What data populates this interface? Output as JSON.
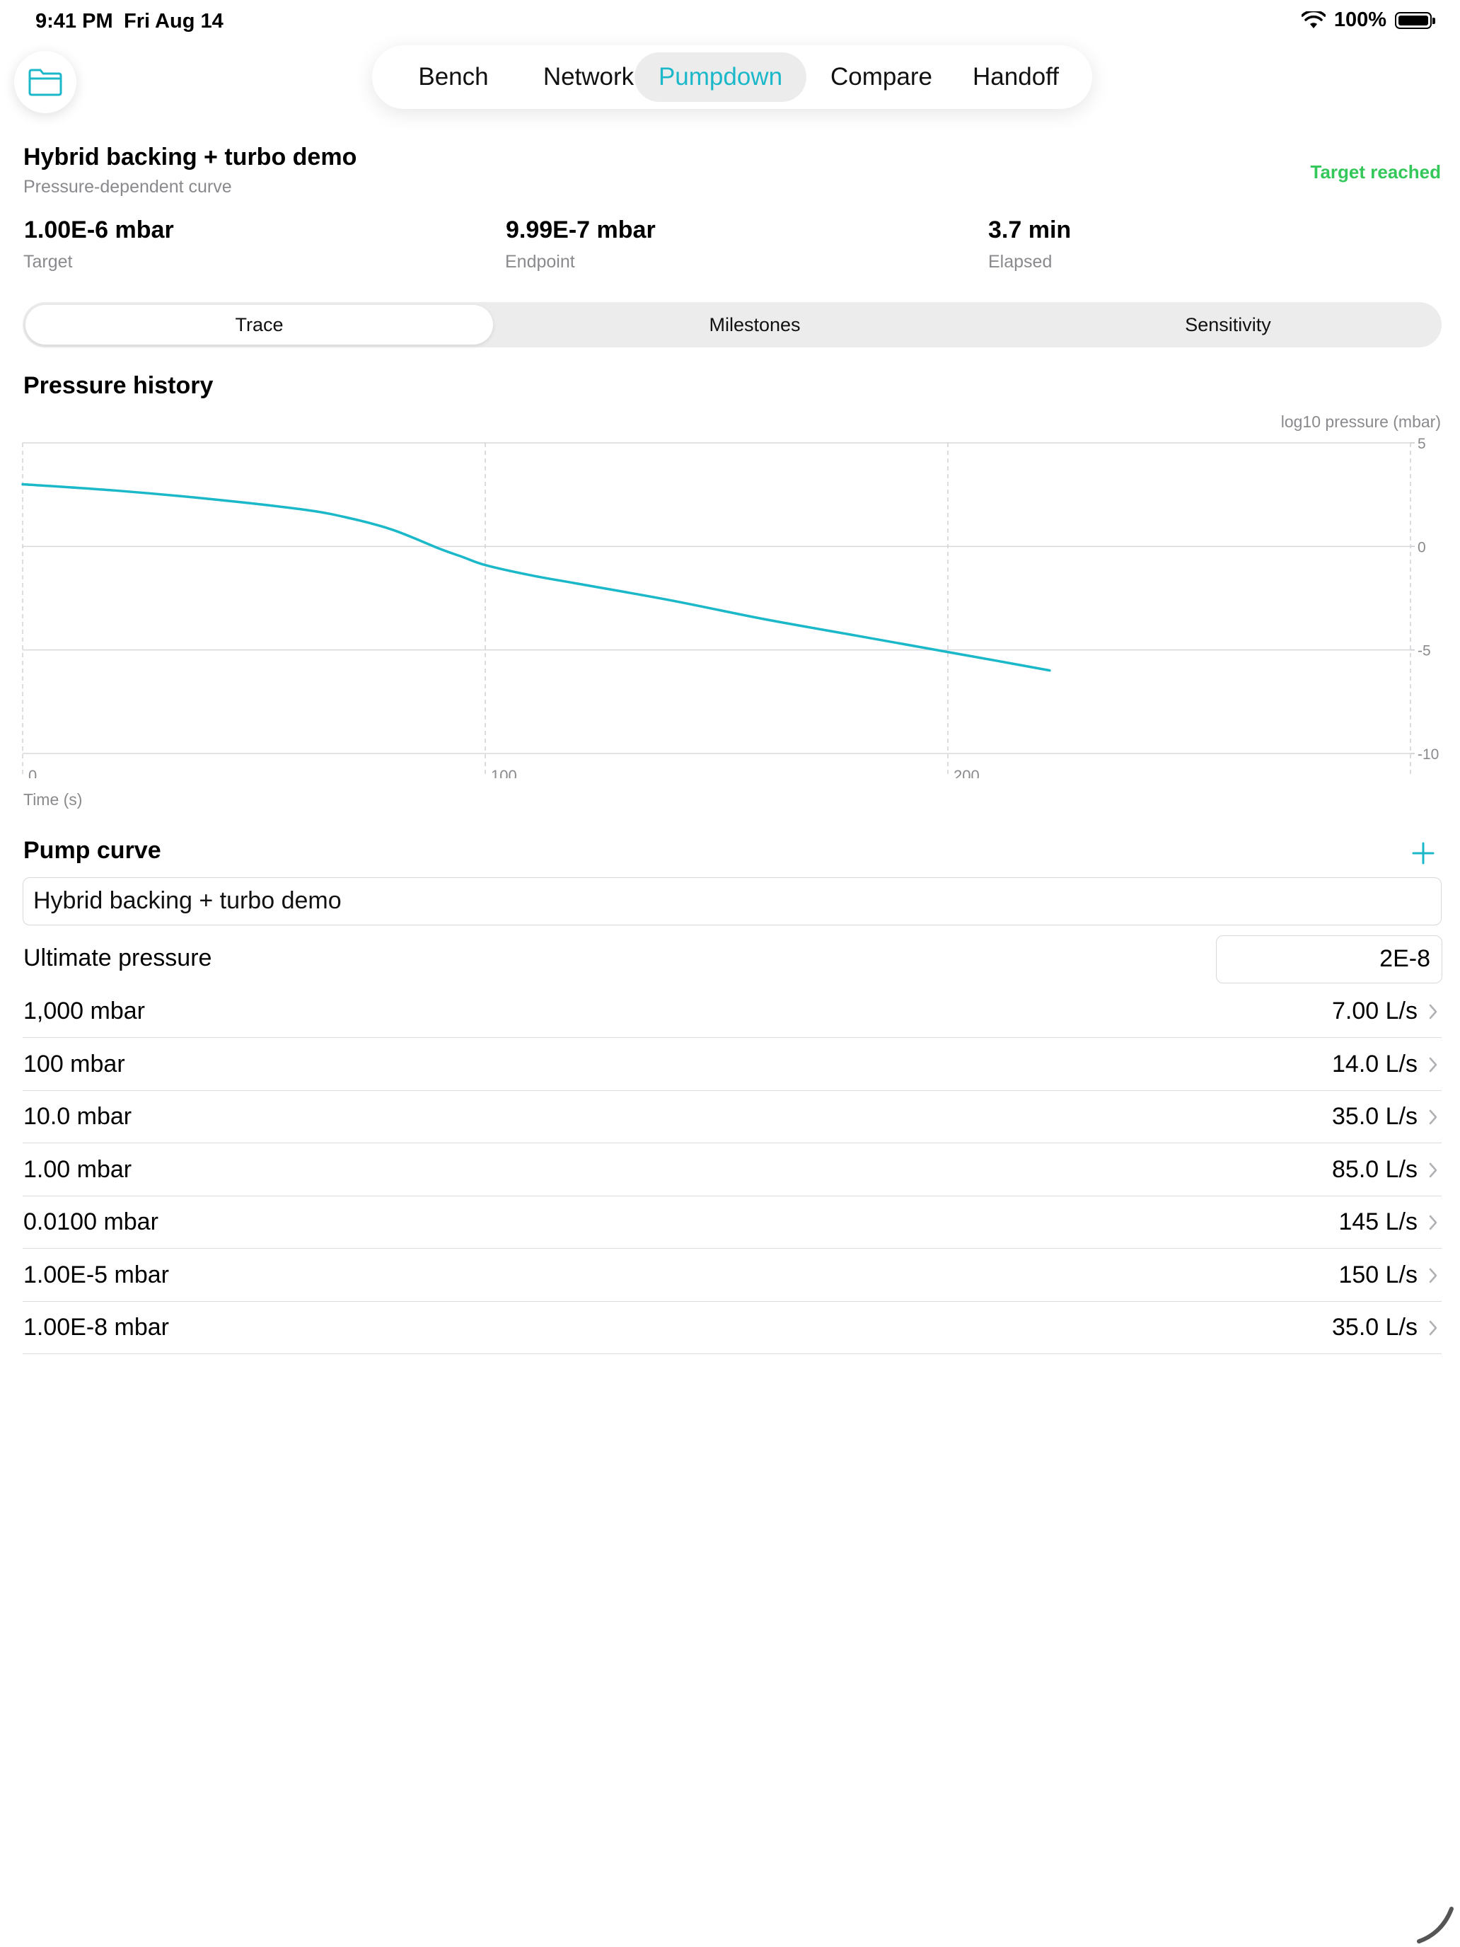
{
  "status_bar": {
    "time": "9:41 PM",
    "date": "Fri Aug 14",
    "battery": "100%"
  },
  "tabs": [
    {
      "label": "Bench",
      "active": false
    },
    {
      "label": "Network",
      "active": false
    },
    {
      "label": "Pumpdown",
      "active": true
    },
    {
      "label": "Compare",
      "active": false
    },
    {
      "label": "Handoff",
      "active": false
    }
  ],
  "header": {
    "title": "Hybrid backing + turbo demo",
    "subtitle": "Pressure-dependent curve",
    "status": "Target reached"
  },
  "metrics": [
    {
      "value": "1.00E-6 mbar",
      "label": "Target"
    },
    {
      "value": "9.99E-7 mbar",
      "label": "Endpoint"
    },
    {
      "value": "3.7 min",
      "label": "Elapsed"
    }
  ],
  "segments": [
    {
      "label": "Trace",
      "active": true
    },
    {
      "label": "Milestones",
      "active": false
    },
    {
      "label": "Sensitivity",
      "active": false
    }
  ],
  "chart_section_title": "Pressure history",
  "chart_data": {
    "type": "line",
    "title": "Pressure history",
    "xlabel": "Time (s)",
    "ylabel": "log10 pressure (mbar)",
    "xlim": [
      0,
      300
    ],
    "ylim": [
      -10,
      5
    ],
    "x_ticks": [
      0,
      100,
      200
    ],
    "y_ticks": [
      5,
      0,
      -5,
      -10
    ],
    "grid": true,
    "series": [
      {
        "color": "#1ab8c9",
        "x": [
          0,
          20,
          40,
          60,
          70,
          80,
          90,
          95,
          100,
          110,
          120,
          140,
          160,
          180,
          200,
          210,
          222
        ],
        "y": [
          3.0,
          2.7,
          2.3,
          1.8,
          1.4,
          0.8,
          -0.1,
          -0.5,
          -0.9,
          -1.4,
          -1.8,
          -2.6,
          -3.5,
          -4.3,
          -5.1,
          -5.5,
          -5.99
        ]
      }
    ]
  },
  "pump_curve": {
    "title": "Pump curve",
    "name": "Hybrid backing + turbo demo",
    "ultimate_label": "Ultimate pressure",
    "ultimate_value": "2E-8",
    "points": [
      {
        "pressure": "1,000 mbar",
        "speed": "7.00 L/s"
      },
      {
        "pressure": "100 mbar",
        "speed": "14.0 L/s"
      },
      {
        "pressure": "10.0 mbar",
        "speed": "35.0 L/s"
      },
      {
        "pressure": "1.00 mbar",
        "speed": "85.0 L/s"
      },
      {
        "pressure": "0.0100 mbar",
        "speed": "145 L/s"
      },
      {
        "pressure": "1.00E-5 mbar",
        "speed": "150 L/s"
      },
      {
        "pressure": "1.00E-8 mbar",
        "speed": "35.0 L/s"
      }
    ]
  },
  "accent_color": "#1ab8c9",
  "success_color": "#34c759"
}
